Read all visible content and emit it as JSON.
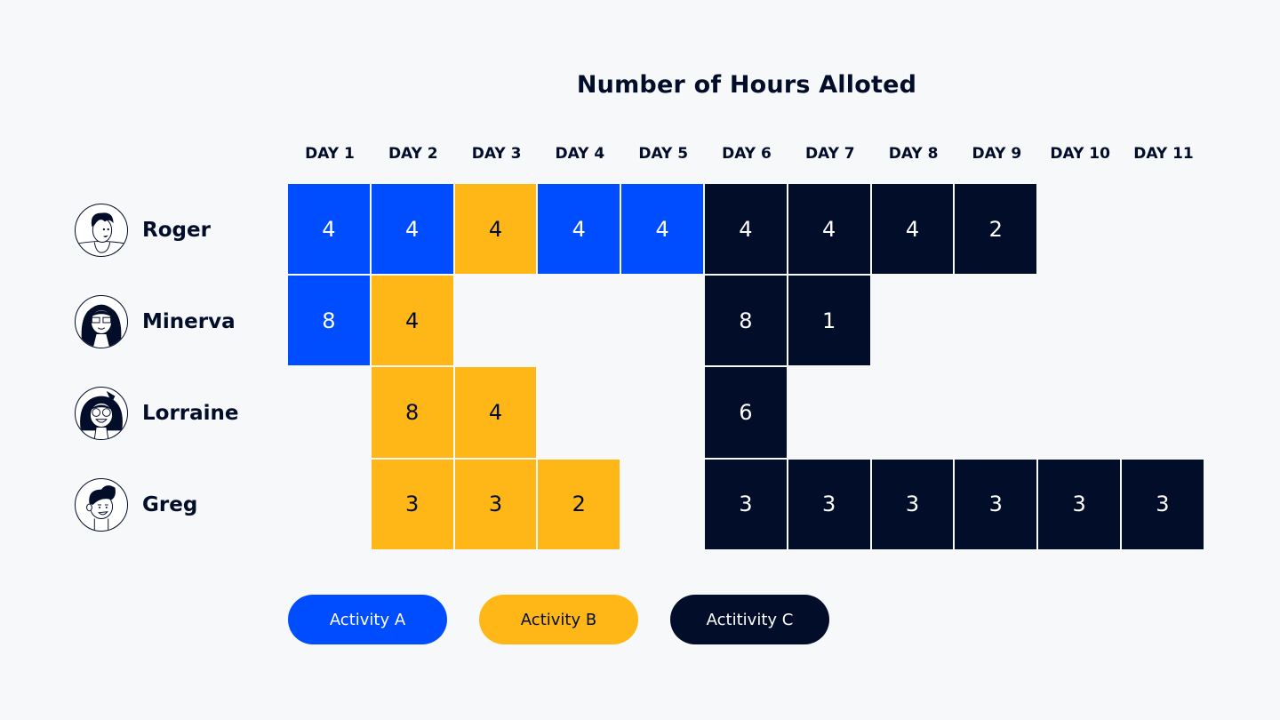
{
  "colors": {
    "activity_a": "#004dff",
    "activity_b": "#ffb717",
    "activity_c": "#020d2a",
    "text_dark": "#020d2a",
    "text_light": "#ffffff",
    "background": "#f7f8fa"
  },
  "chart_data": {
    "type": "heatmap",
    "title": "Number of Hours Alloted",
    "xlabel": "",
    "ylabel": "",
    "columns": [
      "DAY 1",
      "DAY 2",
      "DAY 3",
      "DAY 4",
      "DAY 5",
      "DAY 6",
      "DAY 7",
      "DAY 8",
      "DAY 9",
      "DAY 10",
      "DAY 11"
    ],
    "rows": [
      {
        "name": "Roger",
        "avatar": "avatar-roger-icon",
        "cells": [
          {
            "hours": 4,
            "activity": "A"
          },
          {
            "hours": 4,
            "activity": "A"
          },
          {
            "hours": 4,
            "activity": "B"
          },
          {
            "hours": 4,
            "activity": "A"
          },
          {
            "hours": 4,
            "activity": "A"
          },
          {
            "hours": 4,
            "activity": "C"
          },
          {
            "hours": 4,
            "activity": "C"
          },
          {
            "hours": 4,
            "activity": "C"
          },
          {
            "hours": 2,
            "activity": "C"
          },
          null,
          null
        ]
      },
      {
        "name": "Minerva",
        "avatar": "avatar-minerva-icon",
        "cells": [
          {
            "hours": 8,
            "activity": "A"
          },
          {
            "hours": 4,
            "activity": "B"
          },
          null,
          null,
          null,
          {
            "hours": 8,
            "activity": "C"
          },
          {
            "hours": 1,
            "activity": "C"
          },
          null,
          null,
          null,
          null
        ]
      },
      {
        "name": "Lorraine",
        "avatar": "avatar-lorraine-icon",
        "cells": [
          null,
          {
            "hours": 8,
            "activity": "B"
          },
          {
            "hours": 4,
            "activity": "B"
          },
          null,
          null,
          {
            "hours": 6,
            "activity": "C"
          },
          null,
          null,
          null,
          null,
          null
        ]
      },
      {
        "name": "Greg",
        "avatar": "avatar-greg-icon",
        "cells": [
          null,
          {
            "hours": 3,
            "activity": "B"
          },
          {
            "hours": 3,
            "activity": "B"
          },
          {
            "hours": 2,
            "activity": "B"
          },
          null,
          {
            "hours": 3,
            "activity": "C"
          },
          {
            "hours": 3,
            "activity": "C"
          },
          {
            "hours": 3,
            "activity": "C"
          },
          {
            "hours": 3,
            "activity": "C"
          },
          {
            "hours": 3,
            "activity": "C"
          },
          {
            "hours": 3,
            "activity": "C"
          }
        ]
      }
    ],
    "legend": [
      {
        "key": "A",
        "label": "Activity A"
      },
      {
        "key": "B",
        "label": "Activity B"
      },
      {
        "key": "C",
        "label": "Actitivity C"
      }
    ],
    "legend_position": "bottom"
  }
}
